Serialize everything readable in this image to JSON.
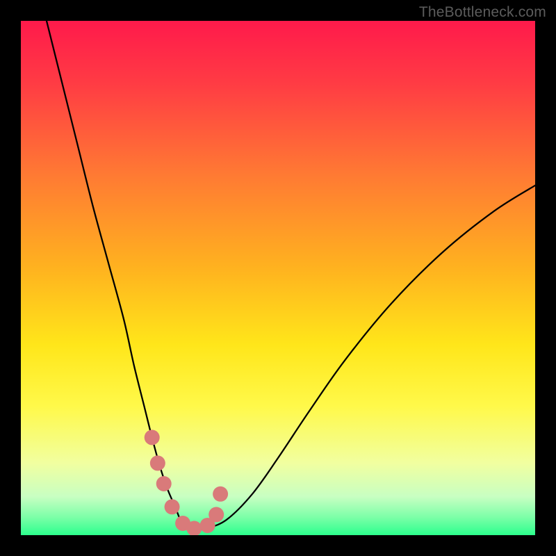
{
  "watermark": "TheBottleneck.com",
  "chart_data": {
    "type": "line",
    "title": "",
    "xlabel": "",
    "ylabel": "",
    "xlim": [
      0,
      100
    ],
    "ylim": [
      0,
      100
    ],
    "background_gradient": {
      "stops": [
        {
          "pos": 0.0,
          "color": "#ff1a4b"
        },
        {
          "pos": 0.12,
          "color": "#ff3b44"
        },
        {
          "pos": 0.3,
          "color": "#ff7a33"
        },
        {
          "pos": 0.48,
          "color": "#ffb21f"
        },
        {
          "pos": 0.63,
          "color": "#ffe61a"
        },
        {
          "pos": 0.75,
          "color": "#fff94a"
        },
        {
          "pos": 0.86,
          "color": "#f1ffa0"
        },
        {
          "pos": 0.925,
          "color": "#c8ffc2"
        },
        {
          "pos": 0.965,
          "color": "#7cffa8"
        },
        {
          "pos": 1.0,
          "color": "#2cff8d"
        }
      ]
    },
    "series": [
      {
        "name": "bottleneck-curve",
        "color": "#000000",
        "stroke_width": 2.3,
        "x": [
          5,
          8,
          11,
          14,
          17,
          20,
          22,
          24,
          25.5,
          27,
          28.5,
          30,
          31,
          32,
          33.5,
          36,
          40,
          45,
          50,
          56,
          63,
          72,
          82,
          92,
          100
        ],
        "y": [
          100,
          88,
          76,
          64,
          53,
          42,
          33,
          25,
          19,
          13.5,
          9,
          5.5,
          3,
          1.5,
          1,
          1.3,
          3,
          8,
          15,
          24,
          34,
          45,
          55,
          63,
          68
        ]
      }
    ],
    "markers": {
      "name": "highlight-dots",
      "color": "#d97a7a",
      "radius": 11,
      "points": [
        {
          "x": 25.5,
          "y": 19
        },
        {
          "x": 26.6,
          "y": 14
        },
        {
          "x": 27.8,
          "y": 10
        },
        {
          "x": 29.4,
          "y": 5.5
        },
        {
          "x": 31.5,
          "y": 2.3
        },
        {
          "x": 33.7,
          "y": 1.3
        },
        {
          "x": 36.3,
          "y": 1.9
        },
        {
          "x": 38.0,
          "y": 4.0
        },
        {
          "x": 38.8,
          "y": 8.0
        }
      ]
    }
  }
}
